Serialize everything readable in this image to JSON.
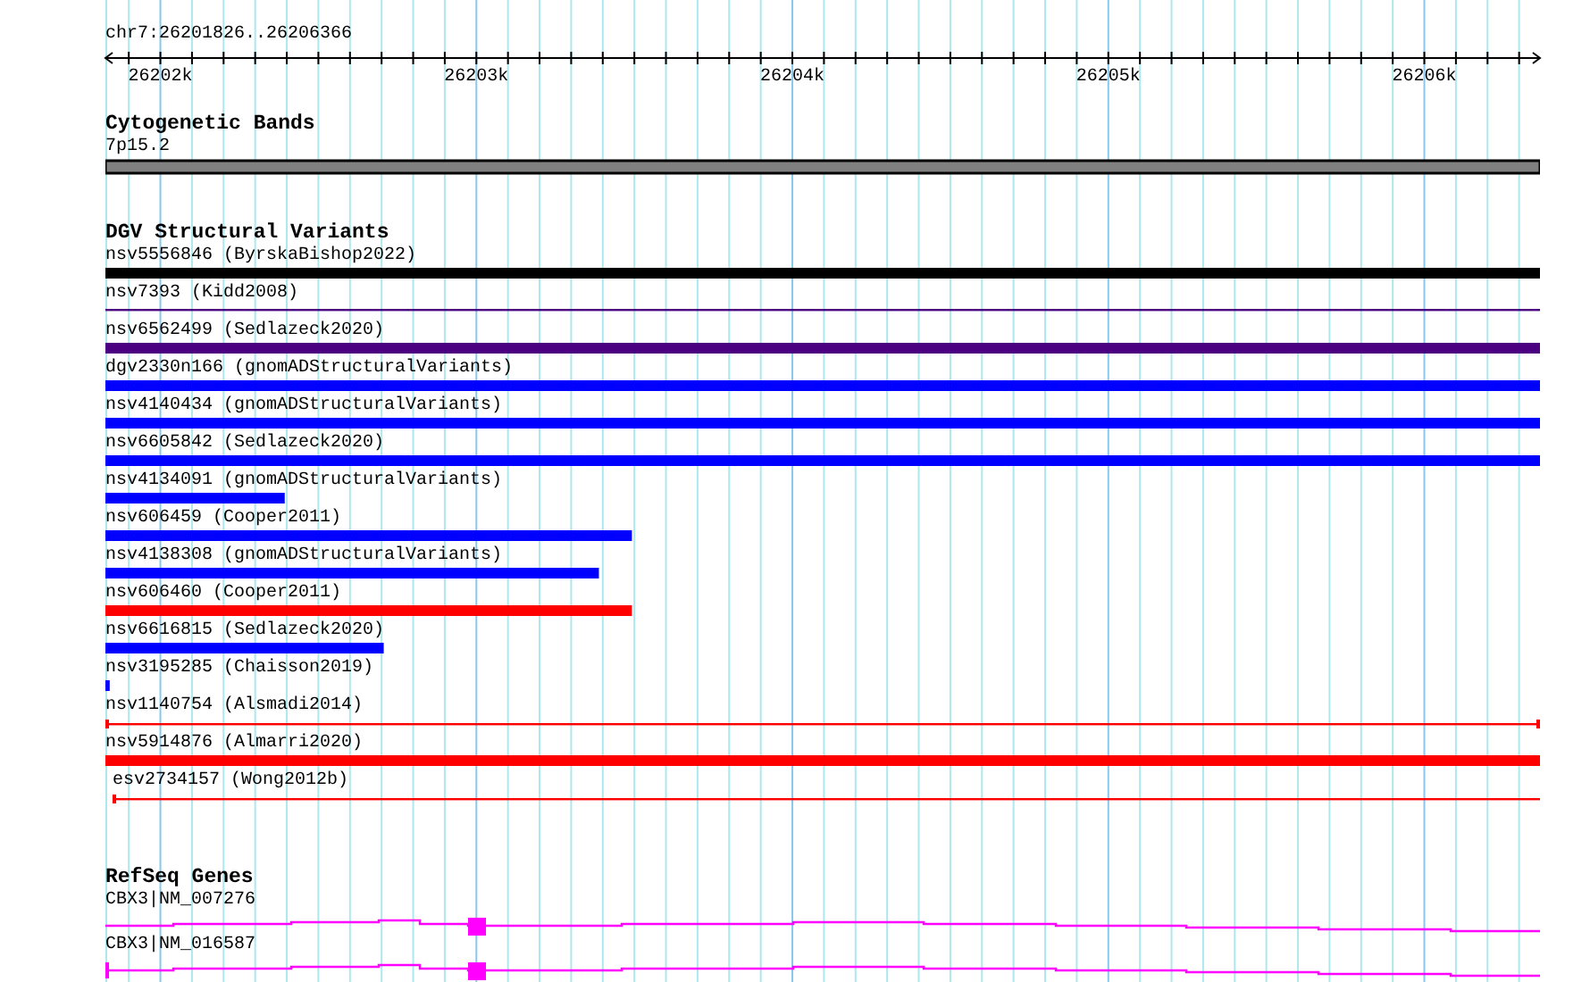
{
  "location": "chr7:26201826..26206366",
  "ruler": {
    "ticks": [
      "26202k",
      "26203k",
      "26204k",
      "26205k",
      "26206k"
    ]
  },
  "tracks": [
    {
      "title": "Cytogenetic Bands",
      "features": [
        {
          "label": "7p15.2",
          "kind": "band"
        }
      ]
    },
    {
      "title": "DGV Structural Variants",
      "features": [
        {
          "label": "nsv5556846 (ByrskaBishop2022)",
          "kind": "bar",
          "color": "#000000",
          "level": 1
        },
        {
          "label": "nsv7393 (Kidd2008)",
          "kind": "line",
          "color": "#4b0082",
          "level": 1
        },
        {
          "label": "nsv6562499 (Sedlazeck2020)",
          "kind": "bar",
          "color": "#4b0082",
          "level": 1
        },
        {
          "label": "dgv2330n166 (gnomADStructuralVariants)",
          "kind": "bar",
          "color": "#0000ff",
          "level": 1
        },
        {
          "label": "nsv4140434 (gnomADStructuralVariants)",
          "kind": "bar",
          "color": "#0000ff",
          "level": 1
        },
        {
          "label": "nsv6605842 (Sedlazeck2020)",
          "kind": "bar",
          "color": "#0000ff",
          "level": 1
        },
        {
          "label": "nsv4134091 (gnomADStructuralVariants)",
          "kind": "bar",
          "color": "#0000ff",
          "level": 0.125
        },
        {
          "label": "nsv606459 (Cooper2011)",
          "kind": "bar",
          "color": "#0000ff",
          "level": 0.367
        },
        {
          "label": "nsv4138308 (gnomADStructuralVariants)",
          "kind": "bar",
          "color": "#0000ff",
          "level": 0.344
        },
        {
          "label": "nsv606460 (Cooper2011)",
          "kind": "bar",
          "color": "#ff0000",
          "level": 0.367
        },
        {
          "label": "nsv6616815 (Sedlazeck2020)",
          "kind": "bar",
          "color": "#0000ff",
          "level": 0.194
        },
        {
          "label": "nsv3195285 (Chaisson2019)",
          "kind": "bar",
          "color": "#0000ff",
          "level": 0.003
        },
        {
          "label": "nsv1140754 (Alsmadi2014)",
          "kind": "capped-line",
          "color": "#ff0000",
          "level": 1
        },
        {
          "label": "nsv5914876 (Almarri2020)",
          "kind": "bar",
          "color": "#ff0000",
          "level": 1
        },
        {
          "label": "esv2734157 (Wong2012b)",
          "kind": "open-line",
          "color": "#ff0000",
          "level": 1
        }
      ]
    },
    {
      "title": "RefSeq Genes",
      "features": [
        {
          "label": "CBX3|NM_007276",
          "kind": "gene"
        },
        {
          "label": "CBX3|NM_016587",
          "kind": "gene-capped"
        }
      ]
    }
  ]
}
